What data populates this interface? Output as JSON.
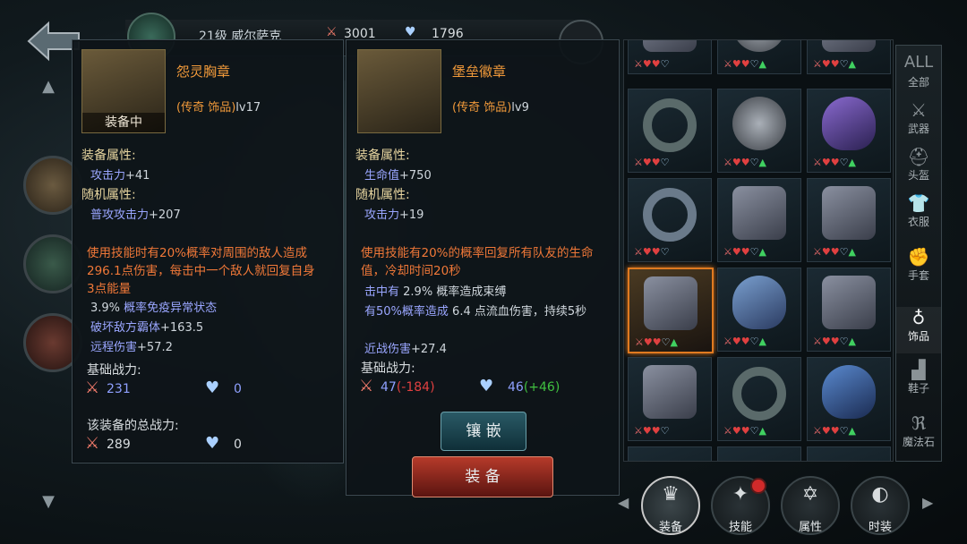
{
  "header": {
    "level_name": "21级 威尔萨克",
    "power": "3001",
    "defense": "1796"
  },
  "equipped": {
    "name": "怨灵胸章",
    "type": "(传奇 饰品)",
    "level": "lv17",
    "tag": "装备中",
    "equip_attr_title": "装备属性:",
    "equip_attr": {
      "label": "攻击力",
      "value": "+41"
    },
    "random_attr_title": "随机属性:",
    "random_attr": {
      "label": "普攻攻击力",
      "value": "+207"
    },
    "effect": "使用技能时有20%概率对周围的敌人造成296.1点伤害，每击中一个敌人就回复自身3点能量",
    "subs": [
      {
        "label": "3.9%",
        "value": "概率免疫异常状态"
      },
      {
        "label": "破坏敌方霸体",
        "value": "+163.5"
      },
      {
        "label": "远程伤害",
        "value": "+57.2"
      }
    ],
    "base_power_title": "基础战力:",
    "base_power": "231",
    "base_defense": "0",
    "total_title": "该装备的总战力:",
    "total_power": "289",
    "total_defense": "0"
  },
  "candidate": {
    "name": "堡垒徽章",
    "type": "(传奇 饰品)",
    "level": "lv9",
    "equip_attr_title": "装备属性:",
    "equip_attr": {
      "label": "生命值",
      "value": "+750"
    },
    "random_attr_title": "随机属性:",
    "random_attr": {
      "label": "攻击力",
      "value": "+19"
    },
    "effect": "使用技能有20%的概率回复所有队友的生命值，冷却时间20秒",
    "subs": [
      {
        "label": "击中有",
        "value": "2.9%  概率造成束缚"
      },
      {
        "label": "有50%概率造成",
        "value": "6.4 点流血伤害，持续5秒"
      },
      {
        "label": "近战伤害",
        "value": "+27.4"
      }
    ],
    "base_power_title": "基础战力:",
    "base_power": "47",
    "base_power_diff": "(-184)",
    "base_defense": "46",
    "base_defense_diff": "(+46)"
  },
  "buttons": {
    "inlay": "镶 嵌",
    "equip": "装 备"
  },
  "categories": [
    {
      "icon": "ALL",
      "label": "全部"
    },
    {
      "icon": "⚔",
      "label": "武器"
    },
    {
      "icon": "⛑",
      "label": "头盔"
    },
    {
      "icon": "👕",
      "label": "衣服"
    },
    {
      "icon": "✊",
      "label": "手套"
    },
    {
      "icon": "♁",
      "label": "饰品"
    },
    {
      "icon": "▟",
      "label": "鞋子"
    },
    {
      "icon": "ℜ",
      "label": "魔法石"
    }
  ],
  "tabs": [
    {
      "icon": "♛",
      "label": "装备"
    },
    {
      "icon": "✦",
      "label": "技能"
    },
    {
      "icon": "✡",
      "label": "属性"
    },
    {
      "icon": "◐",
      "label": "时装"
    }
  ],
  "colors": {
    "accent_orange": "#f29a3a",
    "selection": "#e07a20",
    "stat_blue": "#9aa6ff",
    "negative": "#e04040",
    "positive": "#40c040"
  }
}
